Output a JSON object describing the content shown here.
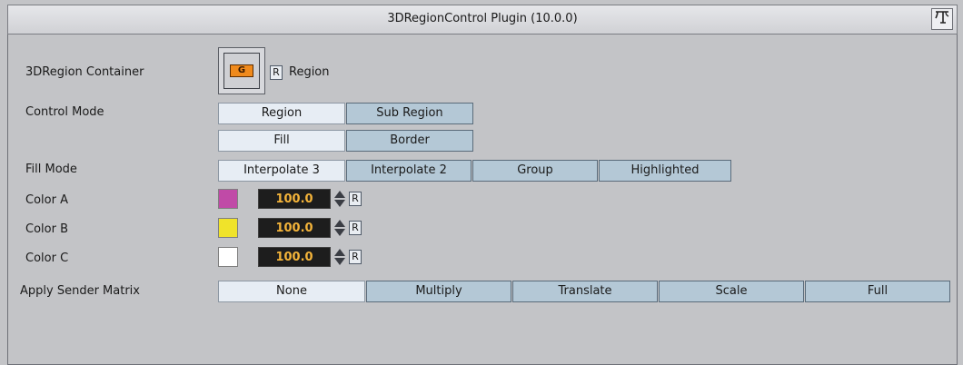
{
  "window": {
    "title": "3DRegionControl Plugin (10.0.0)"
  },
  "rows": {
    "container_label": "3DRegion Container",
    "container_icon_text": "G",
    "container_reset": "R",
    "container_value": "Region",
    "control_mode_label": "Control Mode",
    "control_mode_options": [
      "Region",
      "Sub Region"
    ],
    "control_submode_options": [
      "Fill",
      "Border"
    ],
    "fill_mode_label": "Fill Mode",
    "fill_mode_options": [
      "Interpolate 3",
      "Interpolate 2",
      "Group",
      "Highlighted"
    ],
    "apply_matrix_label": "Apply Sender Matrix",
    "apply_matrix_options": [
      "None",
      "Multiply",
      "Translate",
      "Scale",
      "Full"
    ]
  },
  "colors": [
    {
      "label": "Color A",
      "value": "100.0",
      "swatch": "#c04aa7",
      "reset": "R"
    },
    {
      "label": "Color B",
      "value": "100.0",
      "swatch": "#f0e32a",
      "reset": "R"
    },
    {
      "label": "Color C",
      "value": "100.0",
      "swatch": "#ffffff",
      "reset": "R"
    }
  ],
  "icons": {
    "help": "help-icon",
    "container": "group-container-icon",
    "spinner": "up-down-spinner-icon"
  }
}
